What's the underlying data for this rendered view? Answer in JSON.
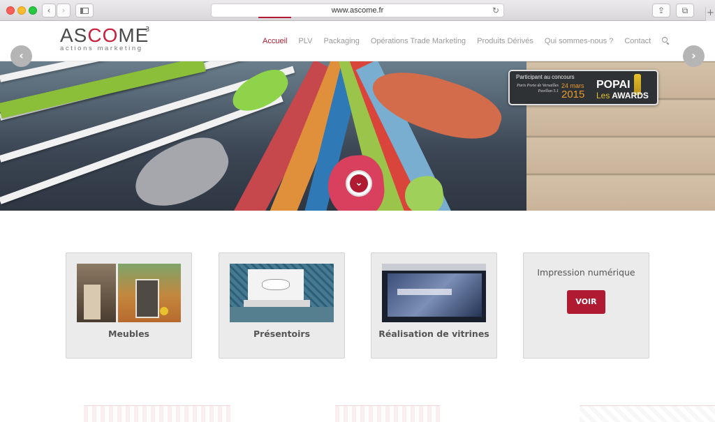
{
  "browser": {
    "url": "www.ascome.fr"
  },
  "header": {
    "logo_main": "ASCOME",
    "logo_sup": "3",
    "logo_sub": "actions marketing",
    "nav": [
      {
        "label": "Accueil",
        "active": true
      },
      {
        "label": "PLV",
        "active": false
      },
      {
        "label": "Packaging",
        "active": false
      },
      {
        "label": "Opérations Trade Marketing",
        "active": false
      },
      {
        "label": "Produits Dérivés",
        "active": false
      },
      {
        "label": "Qui sommes-nous ?",
        "active": false
      },
      {
        "label": "Contact",
        "active": false
      }
    ],
    "search_icon": "search-icon"
  },
  "hero": {
    "badge": {
      "line1": "Participant au concours",
      "place": "Paris Porte de Versailles Pavillon 5.1",
      "date": "24 mars",
      "year": "2015",
      "brand": "POPAI",
      "brand_les": "Les",
      "brand_awards": "AWARDS"
    },
    "down_icon": "chevron-down-icon"
  },
  "cards": [
    {
      "title": "Meubles"
    },
    {
      "title": "Présentoirs"
    },
    {
      "title": "Réalisation de vitrines"
    },
    {
      "heading": "Impression numérique",
      "button": "VOIR"
    }
  ],
  "colors": {
    "accent": "#b01b32",
    "card_bg": "#ebebeb"
  }
}
